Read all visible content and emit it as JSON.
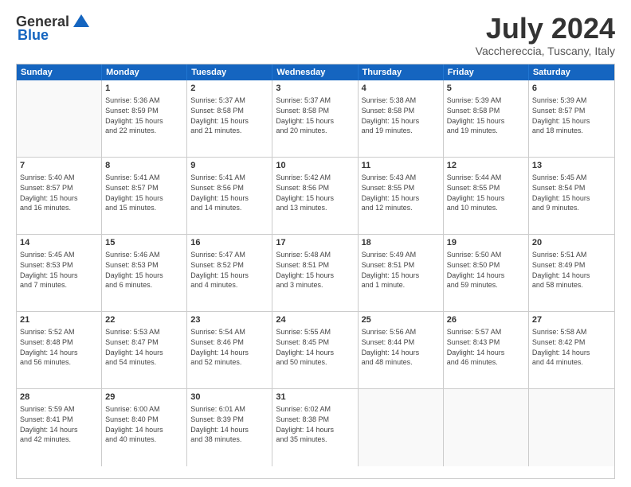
{
  "header": {
    "logo_general": "General",
    "logo_blue": "Blue",
    "month_title": "July 2024",
    "location": "Vacchereccia, Tuscany, Italy"
  },
  "calendar": {
    "days": [
      "Sunday",
      "Monday",
      "Tuesday",
      "Wednesday",
      "Thursday",
      "Friday",
      "Saturday"
    ],
    "weeks": [
      [
        {
          "day": "",
          "sunrise": "",
          "sunset": "",
          "daylight": ""
        },
        {
          "day": "1",
          "sunrise": "Sunrise: 5:36 AM",
          "sunset": "Sunset: 8:59 PM",
          "daylight": "Daylight: 15 hours and 22 minutes."
        },
        {
          "day": "2",
          "sunrise": "Sunrise: 5:37 AM",
          "sunset": "Sunset: 8:58 PM",
          "daylight": "Daylight: 15 hours and 21 minutes."
        },
        {
          "day": "3",
          "sunrise": "Sunrise: 5:37 AM",
          "sunset": "Sunset: 8:58 PM",
          "daylight": "Daylight: 15 hours and 20 minutes."
        },
        {
          "day": "4",
          "sunrise": "Sunrise: 5:38 AM",
          "sunset": "Sunset: 8:58 PM",
          "daylight": "Daylight: 15 hours and 19 minutes."
        },
        {
          "day": "5",
          "sunrise": "Sunrise: 5:39 AM",
          "sunset": "Sunset: 8:58 PM",
          "daylight": "Daylight: 15 hours and 19 minutes."
        },
        {
          "day": "6",
          "sunrise": "Sunrise: 5:39 AM",
          "sunset": "Sunset: 8:57 PM",
          "daylight": "Daylight: 15 hours and 18 minutes."
        }
      ],
      [
        {
          "day": "7",
          "sunrise": "Sunrise: 5:40 AM",
          "sunset": "Sunset: 8:57 PM",
          "daylight": "Daylight: 15 hours and 16 minutes."
        },
        {
          "day": "8",
          "sunrise": "Sunrise: 5:41 AM",
          "sunset": "Sunset: 8:57 PM",
          "daylight": "Daylight: 15 hours and 15 minutes."
        },
        {
          "day": "9",
          "sunrise": "Sunrise: 5:41 AM",
          "sunset": "Sunset: 8:56 PM",
          "daylight": "Daylight: 15 hours and 14 minutes."
        },
        {
          "day": "10",
          "sunrise": "Sunrise: 5:42 AM",
          "sunset": "Sunset: 8:56 PM",
          "daylight": "Daylight: 15 hours and 13 minutes."
        },
        {
          "day": "11",
          "sunrise": "Sunrise: 5:43 AM",
          "sunset": "Sunset: 8:55 PM",
          "daylight": "Daylight: 15 hours and 12 minutes."
        },
        {
          "day": "12",
          "sunrise": "Sunrise: 5:44 AM",
          "sunset": "Sunset: 8:55 PM",
          "daylight": "Daylight: 15 hours and 10 minutes."
        },
        {
          "day": "13",
          "sunrise": "Sunrise: 5:45 AM",
          "sunset": "Sunset: 8:54 PM",
          "daylight": "Daylight: 15 hours and 9 minutes."
        }
      ],
      [
        {
          "day": "14",
          "sunrise": "Sunrise: 5:45 AM",
          "sunset": "Sunset: 8:53 PM",
          "daylight": "Daylight: 15 hours and 7 minutes."
        },
        {
          "day": "15",
          "sunrise": "Sunrise: 5:46 AM",
          "sunset": "Sunset: 8:53 PM",
          "daylight": "Daylight: 15 hours and 6 minutes."
        },
        {
          "day": "16",
          "sunrise": "Sunrise: 5:47 AM",
          "sunset": "Sunset: 8:52 PM",
          "daylight": "Daylight: 15 hours and 4 minutes."
        },
        {
          "day": "17",
          "sunrise": "Sunrise: 5:48 AM",
          "sunset": "Sunset: 8:51 PM",
          "daylight": "Daylight: 15 hours and 3 minutes."
        },
        {
          "day": "18",
          "sunrise": "Sunrise: 5:49 AM",
          "sunset": "Sunset: 8:51 PM",
          "daylight": "Daylight: 15 hours and 1 minute."
        },
        {
          "day": "19",
          "sunrise": "Sunrise: 5:50 AM",
          "sunset": "Sunset: 8:50 PM",
          "daylight": "Daylight: 14 hours and 59 minutes."
        },
        {
          "day": "20",
          "sunrise": "Sunrise: 5:51 AM",
          "sunset": "Sunset: 8:49 PM",
          "daylight": "Daylight: 14 hours and 58 minutes."
        }
      ],
      [
        {
          "day": "21",
          "sunrise": "Sunrise: 5:52 AM",
          "sunset": "Sunset: 8:48 PM",
          "daylight": "Daylight: 14 hours and 56 minutes."
        },
        {
          "day": "22",
          "sunrise": "Sunrise: 5:53 AM",
          "sunset": "Sunset: 8:47 PM",
          "daylight": "Daylight: 14 hours and 54 minutes."
        },
        {
          "day": "23",
          "sunrise": "Sunrise: 5:54 AM",
          "sunset": "Sunset: 8:46 PM",
          "daylight": "Daylight: 14 hours and 52 minutes."
        },
        {
          "day": "24",
          "sunrise": "Sunrise: 5:55 AM",
          "sunset": "Sunset: 8:45 PM",
          "daylight": "Daylight: 14 hours and 50 minutes."
        },
        {
          "day": "25",
          "sunrise": "Sunrise: 5:56 AM",
          "sunset": "Sunset: 8:44 PM",
          "daylight": "Daylight: 14 hours and 48 minutes."
        },
        {
          "day": "26",
          "sunrise": "Sunrise: 5:57 AM",
          "sunset": "Sunset: 8:43 PM",
          "daylight": "Daylight: 14 hours and 46 minutes."
        },
        {
          "day": "27",
          "sunrise": "Sunrise: 5:58 AM",
          "sunset": "Sunset: 8:42 PM",
          "daylight": "Daylight: 14 hours and 44 minutes."
        }
      ],
      [
        {
          "day": "28",
          "sunrise": "Sunrise: 5:59 AM",
          "sunset": "Sunset: 8:41 PM",
          "daylight": "Daylight: 14 hours and 42 minutes."
        },
        {
          "day": "29",
          "sunrise": "Sunrise: 6:00 AM",
          "sunset": "Sunset: 8:40 PM",
          "daylight": "Daylight: 14 hours and 40 minutes."
        },
        {
          "day": "30",
          "sunrise": "Sunrise: 6:01 AM",
          "sunset": "Sunset: 8:39 PM",
          "daylight": "Daylight: 14 hours and 38 minutes."
        },
        {
          "day": "31",
          "sunrise": "Sunrise: 6:02 AM",
          "sunset": "Sunset: 8:38 PM",
          "daylight": "Daylight: 14 hours and 35 minutes."
        },
        {
          "day": "",
          "sunrise": "",
          "sunset": "",
          "daylight": ""
        },
        {
          "day": "",
          "sunrise": "",
          "sunset": "",
          "daylight": ""
        },
        {
          "day": "",
          "sunrise": "",
          "sunset": "",
          "daylight": ""
        }
      ]
    ]
  }
}
